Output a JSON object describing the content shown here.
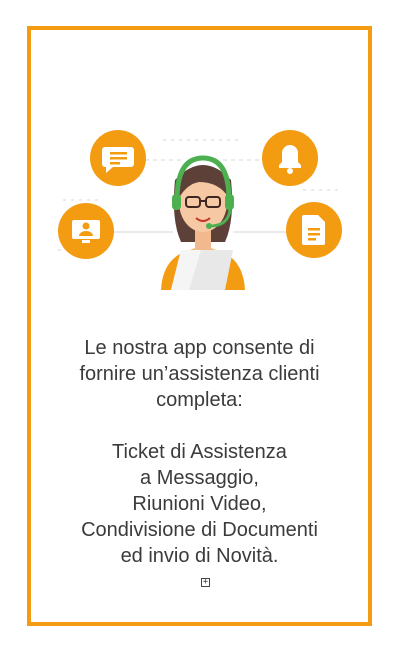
{
  "colors": {
    "border": "#f39c12",
    "accent_orange": "#f39c12",
    "headset_green": "#4caf50",
    "text": "#3b3b3b"
  },
  "illustration": {
    "icons": [
      "chat-bubble-icon",
      "bell-icon",
      "video-call-icon",
      "document-icon"
    ],
    "figure": "support-agent-with-headset"
  },
  "text": {
    "intro_line1": "Le nostra app consente di",
    "intro_line2": "fornire un’assistenza clienti",
    "intro_line3": "completa:",
    "features": [
      "Ticket di Assistenza",
      "a Messaggio,",
      "Riunioni Video,",
      "Condivisione di Documenti",
      "ed invio di Novità."
    ]
  },
  "expand_icon_glyph": "+"
}
